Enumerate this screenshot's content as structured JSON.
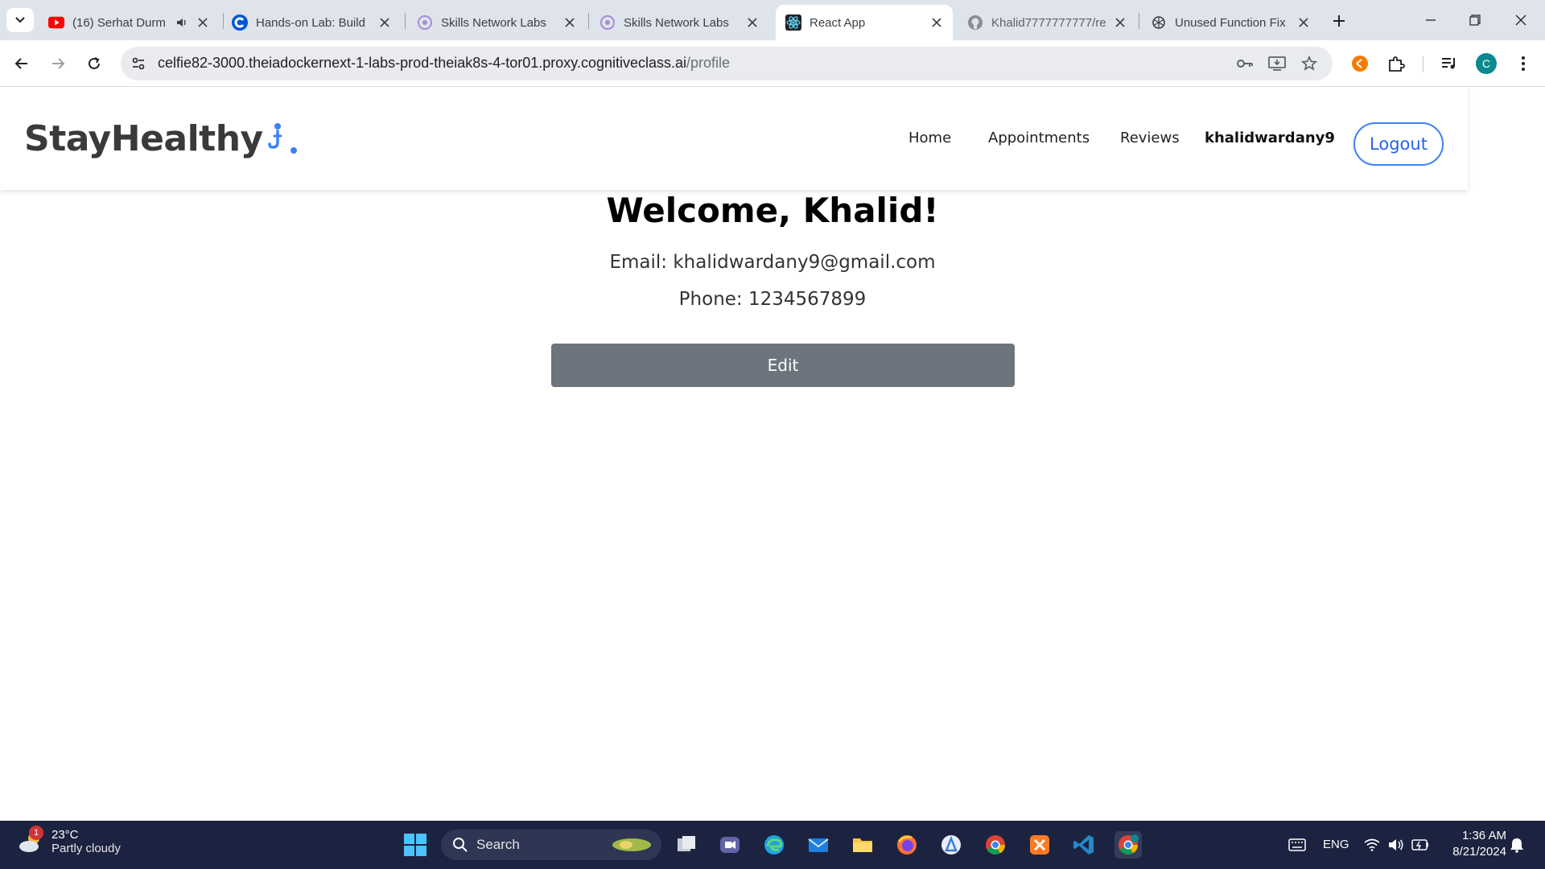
{
  "browser": {
    "tabs": [
      {
        "title": "(16) Serhat Durm",
        "icon": "youtube-icon",
        "audio": true
      },
      {
        "title": "Hands-on Lab: Build",
        "icon": "coursera-icon"
      },
      {
        "title": "Skills Network Labs",
        "icon": "skills-network-icon"
      },
      {
        "title": "Skills Network Labs",
        "icon": "skills-network-icon"
      },
      {
        "title": "React App",
        "icon": "react-icon",
        "active": true
      },
      {
        "title": "Khalid7777777777/re",
        "icon": "github-icon"
      },
      {
        "title": "Unused Function Fix",
        "icon": "openai-icon"
      }
    ],
    "url_host": "celfie82-3000.theiadockernext-1-labs-prod-theiak8s-4-tor01.proxy.cognitiveclass.ai",
    "url_path": "/profile",
    "profile_initial": "C"
  },
  "site": {
    "brand": "StayHealthy",
    "nav": {
      "home": "Home",
      "appointments": "Appointments",
      "reviews": "Reviews",
      "username": "khalidwardany9",
      "logout": "Logout"
    },
    "accent_color": "#3b82f6"
  },
  "profile": {
    "welcome": "Welcome, Khalid!",
    "email": "Email: khalidwardany9@gmail.com",
    "phone": "Phone: 1234567899",
    "edit_label": "Edit"
  },
  "taskbar": {
    "weather_temp": "23°C",
    "weather_desc": "Partly cloudy",
    "weather_badge": "1",
    "search_placeholder": "Search",
    "language": "ENG",
    "time": "1:36 AM",
    "date": "8/21/2024"
  }
}
